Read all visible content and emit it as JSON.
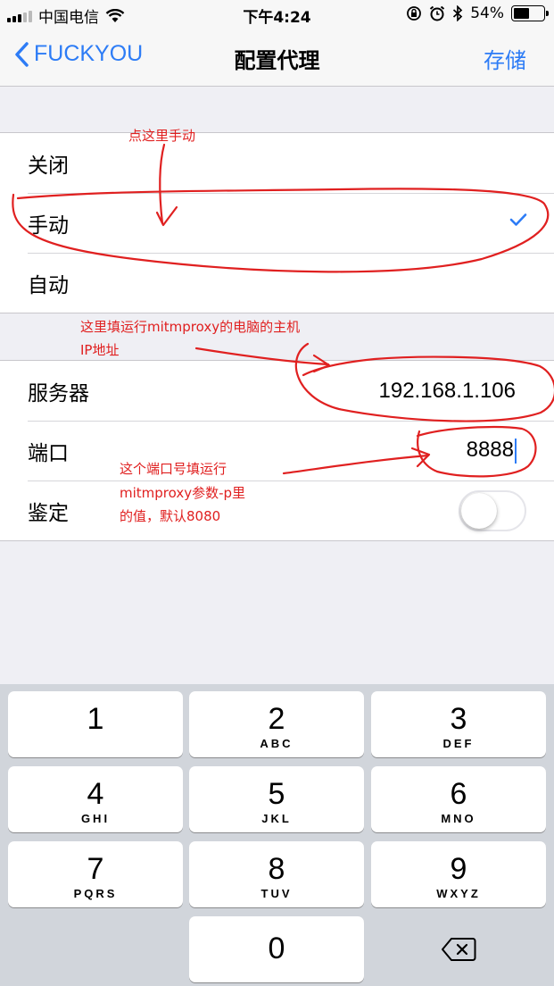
{
  "status_bar": {
    "carrier": "中国电信",
    "time": "下午4:24",
    "battery_percent": "54%",
    "battery_level": 0.54,
    "icons": [
      "signal-icon",
      "wifi-icon",
      "rotation-lock-icon",
      "alarm-icon",
      "bluetooth-icon",
      "battery-icon"
    ]
  },
  "nav": {
    "back_label": "FUCKYOU",
    "title": "配置代理",
    "save_label": "存储"
  },
  "proxy_mode": {
    "options": [
      {
        "label": "关闭",
        "selected": false
      },
      {
        "label": "手动",
        "selected": true
      },
      {
        "label": "自动",
        "selected": false
      }
    ]
  },
  "settings": {
    "server_label": "服务器",
    "server_value": "192.168.1.106",
    "port_label": "端口",
    "port_value": "8888",
    "auth_label": "鉴定",
    "auth_enabled": false
  },
  "keypad": {
    "keys": [
      {
        "num": "1",
        "letters": ""
      },
      {
        "num": "2",
        "letters": "ABC"
      },
      {
        "num": "3",
        "letters": "DEF"
      },
      {
        "num": "4",
        "letters": "GHI"
      },
      {
        "num": "5",
        "letters": "JKL"
      },
      {
        "num": "6",
        "letters": "MNO"
      },
      {
        "num": "7",
        "letters": "PQRS"
      },
      {
        "num": "8",
        "letters": "TUV"
      },
      {
        "num": "9",
        "letters": "WXYZ"
      },
      {
        "num": "0",
        "letters": ""
      }
    ]
  },
  "annotations": {
    "click_manual": "点这里手动",
    "server_hint_line1": "这里填运行mitmproxy的电脑的主机",
    "server_hint_line2": "IP地址",
    "port_hint_line1": "这个端口号填运行",
    "port_hint_line2": "mitmproxy参数-p里",
    "port_hint_line3": "的值，默认8080",
    "color": "#e02020"
  },
  "colors": {
    "accent": "#2d7cf6",
    "background": "#efeff4",
    "keypad_bg": "#d1d5db"
  }
}
